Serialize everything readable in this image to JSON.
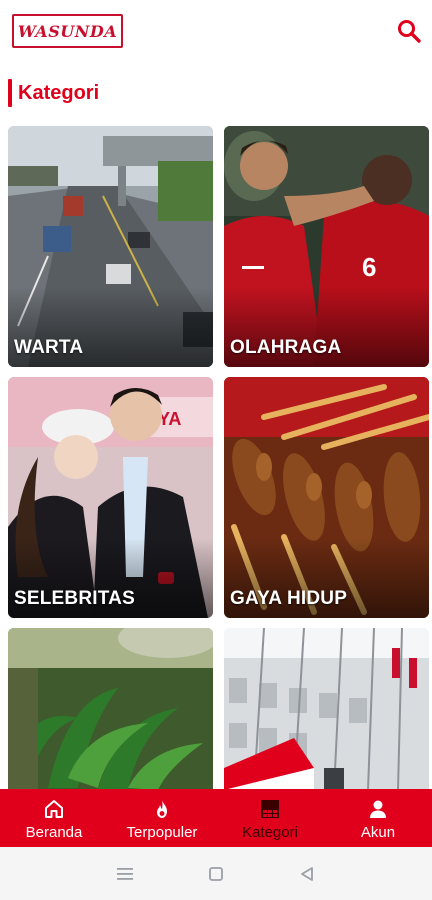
{
  "header": {
    "logo_text": "WASUNDA",
    "search_icon": "search-icon"
  },
  "section": {
    "title": "Kategori"
  },
  "categories": [
    {
      "label": "WARTA",
      "image": "highway-traffic-photo"
    },
    {
      "label": "OLAHRAGA",
      "image": "football-players-photo"
    },
    {
      "label": "SELEBRITAS",
      "image": "celebrity-couple-photo"
    },
    {
      "label": "GAYA HIDUP",
      "image": "satay-food-photo"
    },
    {
      "label": "",
      "image": "tropical-forest-photo"
    },
    {
      "label": "",
      "image": "flag-building-photo"
    }
  ],
  "nav": {
    "items": [
      {
        "label": "Beranda",
        "icon": "home-icon"
      },
      {
        "label": "Terpopuler",
        "icon": "flame-icon"
      },
      {
        "label": "Kategori",
        "icon": "category-grid-icon",
        "active": true
      },
      {
        "label": "Akun",
        "icon": "person-icon"
      }
    ]
  },
  "system": {
    "buttons": [
      "menu-icon",
      "home-square-icon",
      "back-triangle-icon"
    ]
  },
  "colors": {
    "brand_red": "#e0001b",
    "logo_red": "#c8102e",
    "active_label": "#3a0000"
  }
}
